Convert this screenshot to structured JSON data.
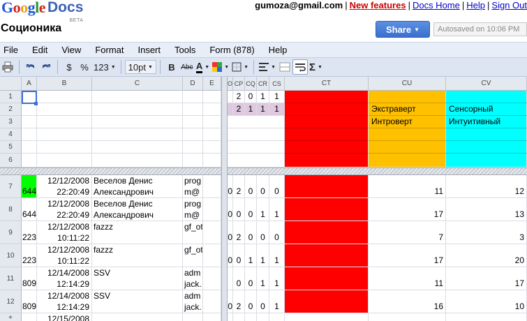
{
  "header": {
    "logo_google": [
      "G",
      "o",
      "o",
      "g",
      "l",
      "e"
    ],
    "logo_docs": "Docs",
    "logo_beta": "BETA",
    "user_email": "gumoza@gmail.com",
    "links": {
      "new_features": "New features",
      "docs_home": "Docs Home",
      "help": "Help",
      "sign_out": "Sign Out"
    },
    "separator": "|",
    "doc_title": "Соционика",
    "share_label": "Share",
    "autosave_text": "Autosaved on 10:06 PM"
  },
  "menu": [
    "File",
    "Edit",
    "View",
    "Format",
    "Insert",
    "Tools",
    "Form (878)",
    "Help"
  ],
  "toolbar": {
    "currency": "$",
    "percent": "%",
    "number_format": "123",
    "font_size": "10pt",
    "bold": "B",
    "strike": "Abc",
    "text_color": "A",
    "sum": "Σ"
  },
  "colors": {
    "red": "#ff0000",
    "orange": "#ffc000",
    "cyan": "#00ffff",
    "green": "#00ff00",
    "lilac": "#e0c8e0",
    "accent": "#3d6fd6"
  },
  "grid": {
    "col_left": [
      "A",
      "B",
      "C",
      "D",
      "E"
    ],
    "col_right": [
      "O",
      "CP",
      "CQ",
      "CR",
      "CS",
      "CT",
      "CU",
      "CV"
    ],
    "frozen_rows": [
      "1",
      "2",
      "3",
      "4",
      "5",
      "6"
    ],
    "frozen_values": {
      "r1": {
        "CP": "2",
        "CQ": "0",
        "CR": "1",
        "CS": "1"
      },
      "r2": {
        "CP": "2",
        "CQ": "1",
        "CR": "1",
        "CS": "1",
        "CU": "Экстраверт",
        "CV": "Сенсорный"
      },
      "r3": {
        "CU": "Интроверт",
        "CV": "Интуитивный"
      }
    },
    "rows": [
      {
        "num": "7",
        "A": "644",
        "B1": "12/12/2008",
        "B2": "22:20:49",
        "C1": "Веселов Денис",
        "C2": "Александрович",
        "D1": "prog",
        "D2": "m@",
        "O": "0",
        "CP": "2",
        "CQ": "0",
        "CR": "0",
        "CS": "0",
        "CU": "11",
        "CV": "12"
      },
      {
        "num": "8",
        "A": "644",
        "B1": "12/12/2008",
        "B2": "22:20:49",
        "C1": "Веселов Денис",
        "C2": "Александрович",
        "D1": "prog",
        "D2": "m@",
        "O": "0",
        "CP": "0",
        "CQ": "0",
        "CR": "1",
        "CS": "1",
        "CU": "17",
        "CV": "13"
      },
      {
        "num": "9",
        "A": "223",
        "B1": "12/12/2008",
        "B2": "10:11:22",
        "C1": "",
        "C2": "fazzz",
        "D1": "",
        "D2": "gf_ot",
        "O": "0",
        "CP": "2",
        "CQ": "0",
        "CR": "0",
        "CS": "0",
        "CU": "7",
        "CV": "3"
      },
      {
        "num": "10",
        "A": "223",
        "B1": "12/12/2008",
        "B2": "10:11:22",
        "C1": "",
        "C2": "fazzz",
        "D1": "",
        "D2": "gf_ot",
        "O": "0",
        "CP": "0",
        "CQ": "1",
        "CR": "1",
        "CS": "1",
        "CU": "17",
        "CV": "20"
      },
      {
        "num": "11",
        "A": "809",
        "B1": "12/14/2008",
        "B2": "12:14:29",
        "C1": "",
        "C2": "SSV",
        "D1": "adm",
        "D2": "jack.",
        "O": "",
        "CP": "0",
        "CQ": "0",
        "CR": "1",
        "CS": "1",
        "CU": "11",
        "CV": "17"
      },
      {
        "num": "12",
        "A": "809",
        "B1": "12/14/2008",
        "B2": "12:14:29",
        "C1": "",
        "C2": "SSV",
        "D1": "adm",
        "D2": "jack.",
        "O": "0",
        "CP": "2",
        "CQ": "0",
        "CR": "0",
        "CS": "1",
        "CU": "16",
        "CV": "10"
      },
      {
        "num": "+",
        "A": "",
        "B1": "12/15/2008",
        "B2": "",
        "C1": "",
        "C2": "",
        "D1": "",
        "D2": "",
        "O": "",
        "CP": "",
        "CQ": "",
        "CR": "",
        "CS": "",
        "CU": "",
        "CV": ""
      }
    ]
  }
}
